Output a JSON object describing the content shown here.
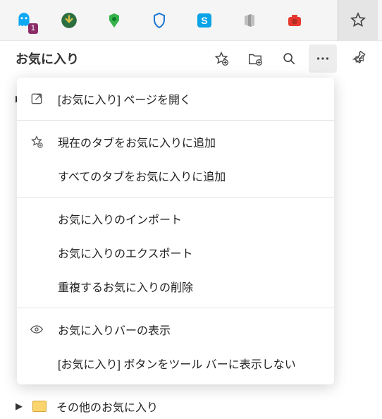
{
  "toolbar": {
    "ext_badge": "1"
  },
  "panel": {
    "title": "お気に入り"
  },
  "menu": {
    "open_page": "[お気に入り] ページを開く",
    "add_current": "現在のタブをお気に入りに追加",
    "add_all": "すべてのタブをお気に入りに追加",
    "import": "お気に入りのインポート",
    "export": "お気に入りのエクスポート",
    "remove_dup": "重複するお気に入りの削除",
    "show_bar": "お気に入りバーの表示",
    "hide_btn": "[お気に入り] ボタンをツール バーに表示しない"
  },
  "bg": {
    "other": "その他のお気に入り"
  }
}
